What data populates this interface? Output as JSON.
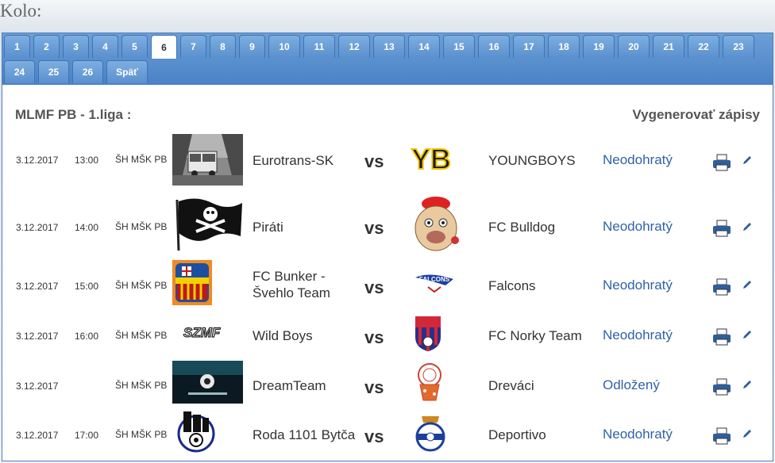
{
  "page": {
    "title": "Kolo:"
  },
  "tabs": [
    {
      "label": "1"
    },
    {
      "label": "2"
    },
    {
      "label": "3"
    },
    {
      "label": "4"
    },
    {
      "label": "5"
    },
    {
      "label": "6",
      "active": true
    },
    {
      "label": "7"
    },
    {
      "label": "8"
    },
    {
      "label": "9"
    },
    {
      "label": "10"
    },
    {
      "label": "11"
    },
    {
      "label": "12"
    },
    {
      "label": "13"
    },
    {
      "label": "14"
    },
    {
      "label": "15"
    },
    {
      "label": "16"
    },
    {
      "label": "17"
    },
    {
      "label": "18"
    },
    {
      "label": "19"
    },
    {
      "label": "20"
    },
    {
      "label": "21"
    },
    {
      "label": "22"
    },
    {
      "label": "23"
    },
    {
      "label": "24"
    },
    {
      "label": "25"
    },
    {
      "label": "26"
    },
    {
      "label": "Späť"
    }
  ],
  "league": {
    "title": "MLMF PB - 1.liga :",
    "generate_label": "Vygenerovať zápisy"
  },
  "vs_label": "vs",
  "matches": [
    {
      "date": "3.12.2017",
      "time": "13:00",
      "venue": "ŠH MŠK PB",
      "home": "Eurotrans-SK",
      "away": "YOUNGBOYS",
      "status": "Neodohratý"
    },
    {
      "date": "3.12.2017",
      "time": "14:00",
      "venue": "ŠH MŠK PB",
      "home": "Piráti",
      "away": "FC Bulldog",
      "status": "Neodohratý"
    },
    {
      "date": "3.12.2017",
      "time": "15:00",
      "venue": "ŠH MŠK PB",
      "home": "FC Bunker - Švehlo Team",
      "away": "Falcons",
      "status": "Neodohratý"
    },
    {
      "date": "3.12.2017",
      "time": "16:00",
      "venue": "ŠH MŠK PB",
      "home": "Wild Boys",
      "away": "FC Norky Team",
      "status": "Neodohratý"
    },
    {
      "date": "3.12.2017",
      "time": "",
      "venue": "ŠH MŠK PB",
      "home": "DreamTeam",
      "away": "Dreváci",
      "status": "Odložený"
    },
    {
      "date": "3.12.2017",
      "time": "17:00",
      "venue": "ŠH MŠK PB",
      "home": "Roda 1101 Bytča",
      "away": "Deportivo",
      "status": "Neodohratý"
    }
  ],
  "logos": {
    "yb_text": "YB",
    "falcons_text": "FALCONS",
    "szmf_text": "SZMF"
  },
  "colors": {
    "tab_blue": "#5a90cf",
    "status_link": "#2f62a8"
  }
}
